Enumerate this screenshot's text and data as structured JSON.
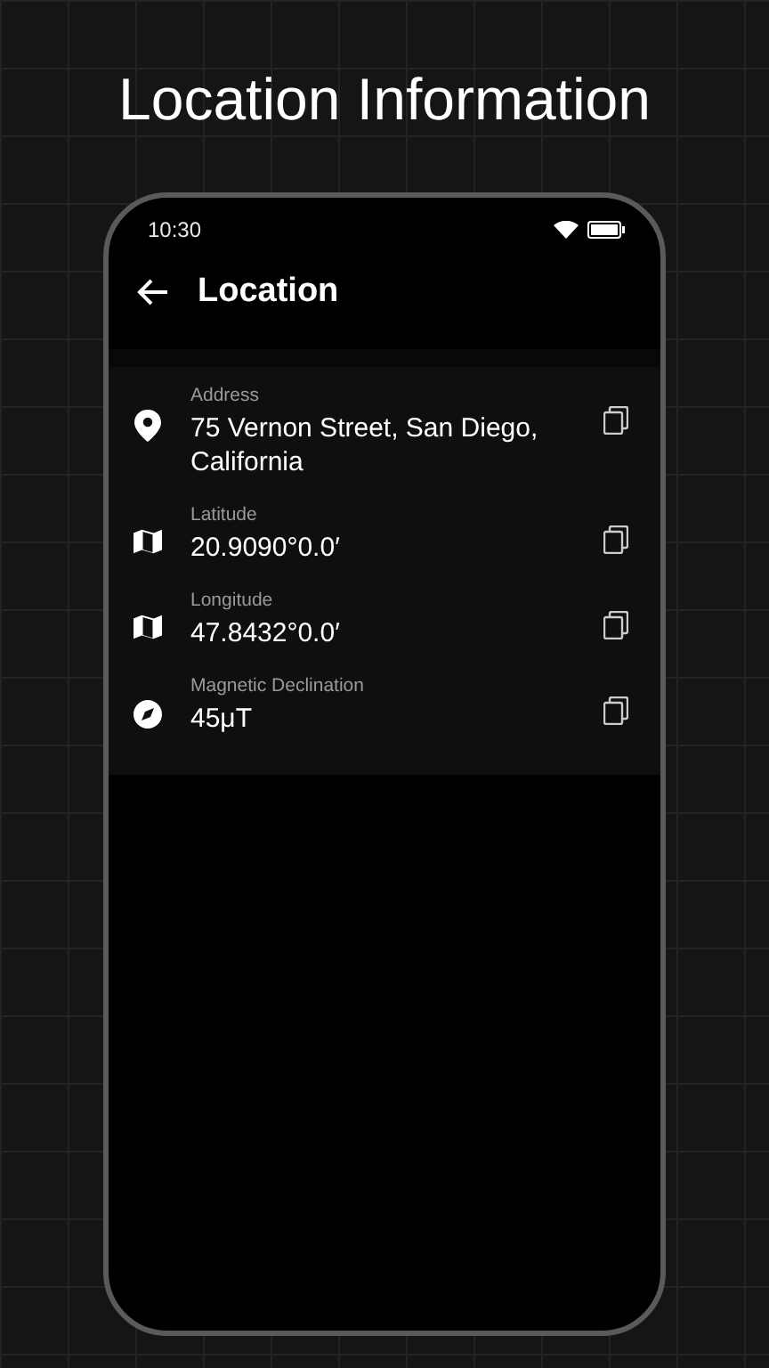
{
  "headline": "Location Information",
  "status_bar": {
    "time": "10:30"
  },
  "app_bar": {
    "title": "Location"
  },
  "fields": [
    {
      "kind": "pin",
      "label": "Address",
      "value": "75 Vernon Street, San Diego, California"
    },
    {
      "kind": "map",
      "label": "Latitude",
      "value": "20.9090°0.0′"
    },
    {
      "kind": "map",
      "label": "Longitude",
      "value": "47.8432°0.0′"
    },
    {
      "kind": "compass",
      "label": "Magnetic Declination",
      "value": "45μT"
    }
  ]
}
